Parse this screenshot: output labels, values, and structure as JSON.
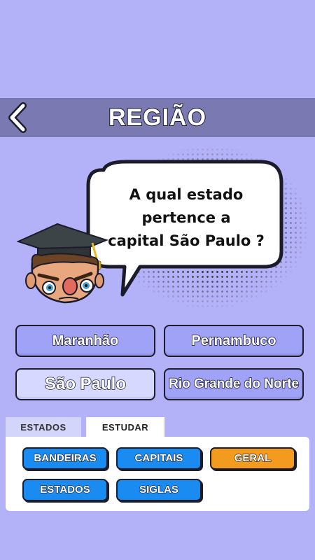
{
  "header": {
    "title": "REGIÃO",
    "back_icon": "chevron-left-icon"
  },
  "question": {
    "line1": "A qual estado pertence a",
    "line2": "capital São Paulo ?"
  },
  "answers": [
    {
      "label": "Maranhão"
    },
    {
      "label": "Pernambuco"
    },
    {
      "label": "São Paulo",
      "selected": true
    },
    {
      "label": "Rio Grande do Norte"
    }
  ],
  "tabs": [
    {
      "label": "ESTADOS",
      "active": false
    },
    {
      "label": "ESTUDAR",
      "active": true
    }
  ],
  "study_buttons": [
    {
      "label": "BANDEIRAS",
      "color": "#1a8cf1"
    },
    {
      "label": "CAPITAIS",
      "color": "#1a8cf1"
    },
    {
      "label": "GERAL",
      "color": "#f39b1f"
    },
    {
      "label": "ESTADOS",
      "color": "#1a8cf1"
    },
    {
      "label": "SIGLAS",
      "color": "#1a8cf1"
    }
  ],
  "colors": {
    "background": "#b3b1f7",
    "header": "#7b79b2",
    "answer": "#9fa2f6",
    "answer_selected": "#d6d8ff"
  }
}
